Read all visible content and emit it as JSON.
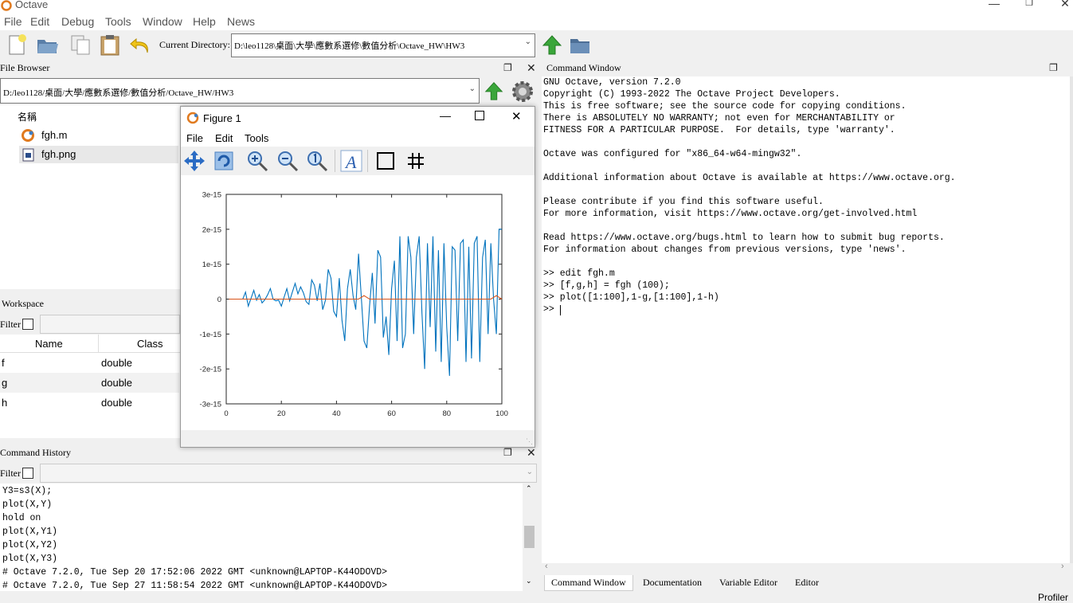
{
  "app": {
    "title": "Octave"
  },
  "menu": [
    "File",
    "Edit",
    "Debug",
    "Tools",
    "Window",
    "Help",
    "News"
  ],
  "toolbar": {
    "current_dir_label": "Current Directory:",
    "current_dir_value": "D:\\leo1128\\桌面\\大學\\應數系選修\\數值分析\\Octave_HW\\HW3"
  },
  "file_browser": {
    "title": "File Browser",
    "path": "D:/leo1128/桌面/大學/應數系選修/數值分析/Octave_HW/HW3",
    "column": "名稱",
    "files": [
      "fgh.m",
      "fgh.png"
    ]
  },
  "workspace": {
    "title": "Workspace",
    "filter_label": "Filter",
    "columns": [
      "Name",
      "Class"
    ],
    "rows": [
      {
        "name": "f",
        "class": "double"
      },
      {
        "name": "g",
        "class": "double"
      },
      {
        "name": "h",
        "class": "double"
      }
    ]
  },
  "history": {
    "title": "Command History",
    "filter_label": "Filter",
    "lines": [
      "Y3=s3(X);",
      "plot(X,Y)",
      "hold on",
      "plot(X,Y1)",
      "plot(X,Y2)",
      "plot(X,Y3)",
      "# Octave 7.2.0, Tue Sep 20 17:52:06 2022 GMT <unknown@LAPTOP-K44ODOVD>",
      "# Octave 7.2.0, Tue Sep 27 11:58:54 2022 GMT <unknown@LAPTOP-K44ODOVD>"
    ]
  },
  "command_window": {
    "title": "Command Window",
    "lines": [
      "GNU Octave, version 7.2.0",
      "Copyright (C) 1993-2022 The Octave Project Developers.",
      "This is free software; see the source code for copying conditions.",
      "There is ABSOLUTELY NO WARRANTY; not even for MERCHANTABILITY or",
      "FITNESS FOR A PARTICULAR PURPOSE.  For details, type 'warranty'.",
      "",
      "Octave was configured for \"x86_64-w64-mingw32\".",
      "",
      "Additional information about Octave is available at https://www.octave.org.",
      "",
      "Please contribute if you find this software useful.",
      "For more information, visit https://www.octave.org/get-involved.html",
      "",
      "Read https://www.octave.org/bugs.html to learn how to submit bug reports.",
      "For information about changes from previous versions, type 'news'.",
      "",
      ">> edit fgh.m",
      ">> [f,g,h] = fgh (100);",
      ">> plot([1:100],1-g,[1:100],1-h)",
      ">> "
    ]
  },
  "bottom_tabs": [
    "Command Window",
    "Documentation",
    "Variable Editor",
    "Editor"
  ],
  "status_partial": "Profiler",
  "figure": {
    "title": "Figure 1",
    "menu": [
      "File",
      "Edit",
      "Tools"
    ]
  },
  "chart_data": {
    "type": "line",
    "xlim": [
      0,
      100
    ],
    "ylim": [
      -3e-15,
      3e-15
    ],
    "xticks": [
      0,
      20,
      40,
      60,
      80,
      100
    ],
    "yticks": [
      3e-15,
      2e-15,
      1e-15,
      0,
      -1e-15,
      -2e-15,
      -3e-15
    ],
    "xtick_labels": [
      "0",
      "20",
      "40",
      "60",
      "80",
      "100"
    ],
    "ytick_labels": [
      "3e-15",
      "2e-15",
      "1e-15",
      "0",
      "-1e-15",
      "-2e-15",
      "-3e-15"
    ],
    "series": [
      {
        "color": "#0072bd",
        "x": [
          1,
          2,
          3,
          4,
          5,
          6,
          7,
          8,
          9,
          10,
          11,
          12,
          13,
          14,
          15,
          16,
          17,
          18,
          19,
          20,
          21,
          22,
          23,
          24,
          25,
          26,
          27,
          28,
          29,
          30,
          31,
          32,
          33,
          34,
          35,
          36,
          37,
          38,
          39,
          40,
          41,
          42,
          43,
          44,
          45,
          46,
          47,
          48,
          49,
          50,
          51,
          52,
          53,
          54,
          55,
          56,
          57,
          58,
          59,
          60,
          61,
          62,
          63,
          64,
          65,
          66,
          67,
          68,
          69,
          70,
          71,
          72,
          73,
          74,
          75,
          76,
          77,
          78,
          79,
          80,
          81,
          82,
          83,
          84,
          85,
          86,
          87,
          88,
          89,
          90,
          91,
          92,
          93,
          94,
          95,
          96,
          97,
          98,
          99,
          100
        ],
        "y": [
          0,
          0,
          0,
          0,
          0,
          0,
          2e-16,
          -2e-16,
          2e-17,
          2.5e-16,
          -3e-17,
          1.3e-16,
          -1.1e-16,
          -2e-17,
          1.2e-16,
          3e-16,
          0,
          -5e-17,
          -3e-17,
          -2e-16,
          6e-17,
          3e-16,
          -5e-17,
          2e-16,
          4.5e-16,
          1.5e-16,
          3.5e-16,
          1.8e-16,
          -7e-17,
          -1.5e-16,
          5.5e-16,
          4e-16,
          -5e-17,
          4.5e-16,
          -3e-16,
          -3e-17,
          8.5e-16,
          6e-16,
          -3.5e-16,
          -5e-16,
          6e-16,
          -6e-16,
          -1.2e-15,
          3e-16,
          8.5e-16,
          1e-16,
          -3e-16,
          1.3e-15,
          8e-17,
          -1.2e-15,
          -1.4e-15,
          -2e-16,
          7.5e-16,
          -7e-16,
          1.4e-15,
          1.2e-15,
          -1.1e-15,
          -5e-16,
          -1.6e-15,
          3e-16,
          1.1e-15,
          -1.2e-15,
          1.8e-15,
          -1.4e-15,
          -1e-15,
          1.8e-15,
          1.2e-15,
          -1e-15,
          1.2e-15,
          1.8e-15,
          -4e-16,
          -2e-15,
          1.6e-15,
          -8e-16,
          1.8e-15,
          -1.5e-15,
          1.4e-15,
          -1.8e-15,
          1.6e-15,
          -8e-16,
          -2.2e-15,
          1.5e-15,
          1.4e-15,
          -1.2e-15,
          1.6e-15,
          1.7e-15,
          -1.8e-15,
          1.5e-15,
          -1.7e-15,
          1.6e-15,
          1.8e-15,
          -1.8e-15,
          1.2e-15,
          1.7e-15,
          -1e-15,
          1.6e-15,
          0,
          -1e-15,
          2e-15,
          2e-15
        ]
      },
      {
        "color": "#d95319",
        "x": [
          1,
          48,
          49,
          50,
          51,
          52,
          96,
          97,
          98,
          99,
          100
        ],
        "y": [
          0,
          0,
          5e-17,
          1e-16,
          5e-17,
          0,
          0,
          5e-17,
          1e-16,
          5e-17,
          0
        ]
      }
    ]
  }
}
